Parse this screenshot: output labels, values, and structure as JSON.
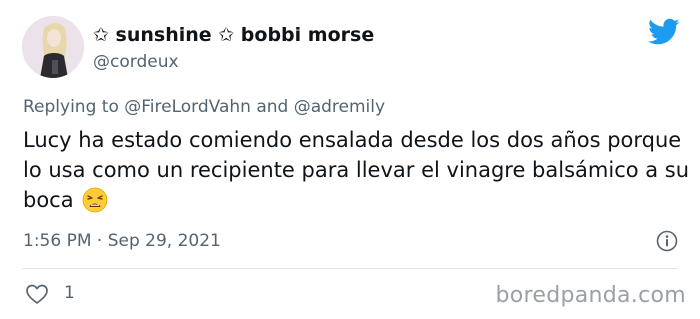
{
  "user": {
    "display_name": "✩ sunshine ✩ bobbi morse",
    "handle": "@cordeux"
  },
  "reply": {
    "prefix": "Replying to ",
    "mention1": "@FireLordVahn",
    "conjunction": " and ",
    "mention2": "@adremily"
  },
  "tweet": {
    "text": "Lucy ha estado comiendo ensalada desde los dos años porque lo usa como un recipiente para llevar el vinagre balsámico a su boca",
    "emoji": "weary-face-emoji",
    "timestamp": "1:56 PM · Sep 29, 2021"
  },
  "actions": {
    "like_count": "1"
  },
  "watermark": "boredpanda.com",
  "icons": {
    "brand": "twitter-bird-icon",
    "info": "info-icon",
    "like": "heart-icon"
  },
  "colors": {
    "twitter_blue": "#1d9bf0",
    "secondary_text": "#536471",
    "primary_text": "#0f1419"
  }
}
